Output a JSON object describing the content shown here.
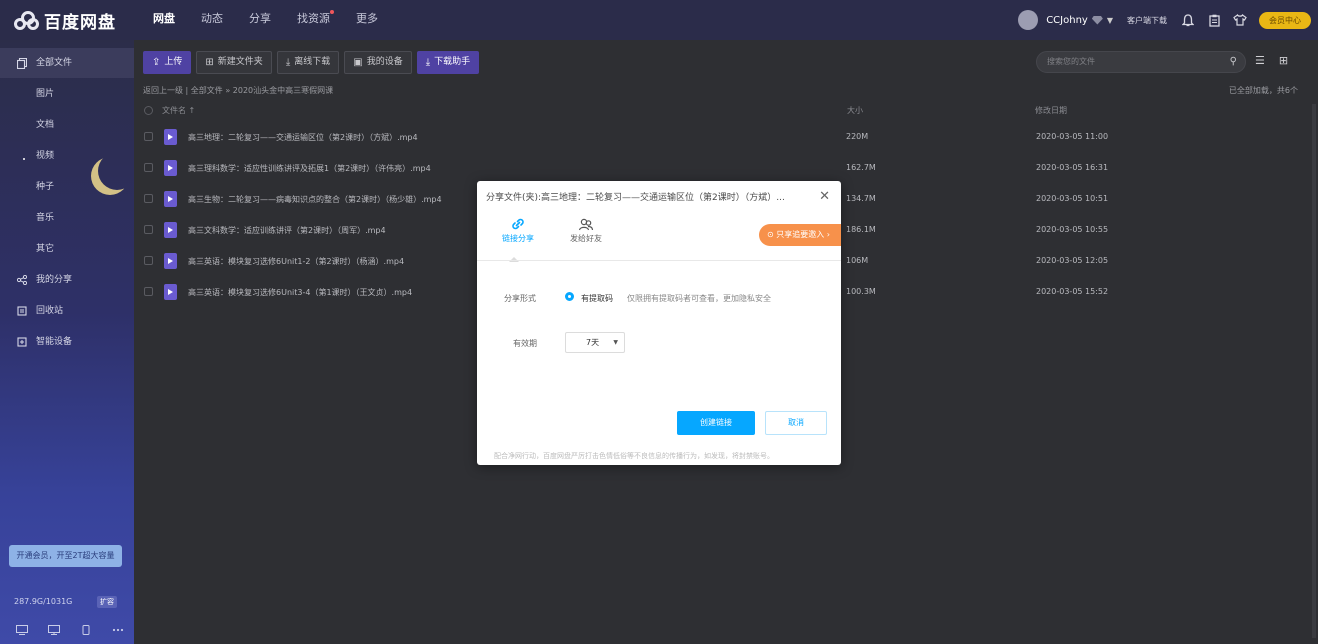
{
  "app": {
    "logo_text": "百度网盘"
  },
  "nav": {
    "items": [
      {
        "label": "网盘"
      },
      {
        "label": "动态"
      },
      {
        "label": "分享"
      },
      {
        "label": "找资源"
      },
      {
        "label": "更多"
      }
    ]
  },
  "user": {
    "name": "CCJohny",
    "client_download": "客户端下载",
    "vip_button": "会员中心"
  },
  "sidebar": {
    "items": [
      {
        "label": "全部文件",
        "icon": "file-stack-icon"
      },
      {
        "label": "图片"
      },
      {
        "label": "文档"
      },
      {
        "label": "视频"
      },
      {
        "label": "种子"
      },
      {
        "label": "音乐"
      },
      {
        "label": "其它"
      },
      {
        "label": "我的分享",
        "icon": "share-icon"
      },
      {
        "label": "回收站",
        "icon": "trash-icon"
      },
      {
        "label": "智能设备",
        "icon": "device-icon"
      }
    ],
    "vip_banner": "开通会员，开至2T超大容量",
    "storage": "287.9G/1031G",
    "expand": "扩容"
  },
  "toolbar": {
    "upload": "上传",
    "new_folder": "新建文件夹",
    "offline_download": "离线下载",
    "my_devices": "我的设备",
    "download_helper": "下载助手"
  },
  "search": {
    "placeholder": "搜索您的文件"
  },
  "breadcrumb": "返回上一级 | 全部文件 » 2020汕头金中高三寒假网课",
  "loaded_status": "已全部加载，共6个",
  "table": {
    "headers": {
      "name": "文件名",
      "size": "大小",
      "date": "修改日期"
    },
    "rows": [
      {
        "name": "高三地理：二轮复习——交通运输区位（第2课时）（方斌）.mp4",
        "size": "220M",
        "date": "2020-03-05 11:00"
      },
      {
        "name": "高三理科数学：适应性训练讲评及拓展1（第2课时）（许伟亮）.mp4",
        "size": "162.7M",
        "date": "2020-03-05 16:31"
      },
      {
        "name": "高三生物：二轮复习——病毒知识点的整合（第2课时）（杨少雄）.mp4",
        "size": "134.7M",
        "date": "2020-03-05 10:51"
      },
      {
        "name": "高三文科数学：适应训练讲评（第2课时）（周军）.mp4",
        "size": "186.1M",
        "date": "2020-03-05 10:55"
      },
      {
        "name": "高三英语：模块复习选修6Unit1-2（第2课时）（杨涵）.mp4",
        "size": "106M",
        "date": "2020-03-05 12:05"
      },
      {
        "name": "高三英语：模块复习选修6Unit3-4（第1课时）（王文贞）.mp4",
        "size": "100.3M",
        "date": "2020-03-05 15:52"
      }
    ]
  },
  "modal": {
    "title": "分享文件(夹):高三地理：二轮复习——交通运输区位（第2课时）（方斌）...",
    "tab_link": "链接分享",
    "tab_friend": "发给好友",
    "invite": "只享追要邀入",
    "share_form_label": "分享形式",
    "radio_label": "有提取码",
    "radio_hint": "仅限拥有提取码者可查看，更加隐私安全",
    "validity_label": "有效期",
    "validity_value": "7天",
    "create_button": "创建链接",
    "cancel_button": "取消",
    "footnote": "配合净网行动，百度网盘严厉打击色情低俗等不良信息的传播行为，如发现，将封禁账号。",
    "accent_color": "#06a7ff"
  }
}
